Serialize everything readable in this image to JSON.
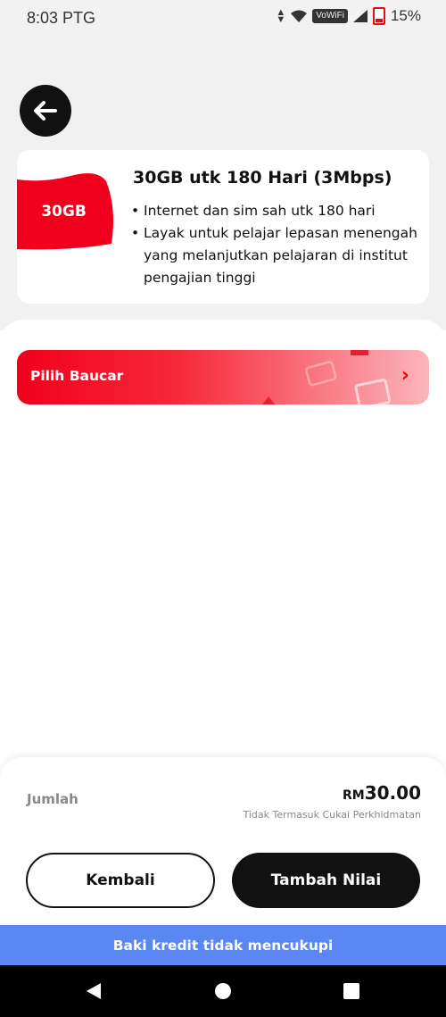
{
  "status_bar": {
    "time": "8:03 PTG",
    "vowifi": "VoWiFi",
    "battery": "15%"
  },
  "product_card": {
    "badge": "30GB",
    "title": "30GB utk 180 Hari (3Mbps)",
    "bullets": [
      "Internet dan sim sah utk 180 hari",
      "Layak untuk pelajar lepasan menengah yang melanjutkan pelajaran di institut pengajian tinggi"
    ]
  },
  "voucher": {
    "label": "Pilih Baucar"
  },
  "summary": {
    "total_label": "Jumlah",
    "currency": "RM",
    "amount": "30.00",
    "tax_note": "Tidak Termasuk Cukai Perkhidmatan"
  },
  "buttons": {
    "back": "Kembali",
    "topup": "Tambah Nilai"
  },
  "banner": {
    "message": "Baki kredit tidak mencukupi"
  },
  "colors": {
    "accent_red": "#f0001c",
    "banner_blue": "#5b87f3",
    "dark": "#111111"
  }
}
